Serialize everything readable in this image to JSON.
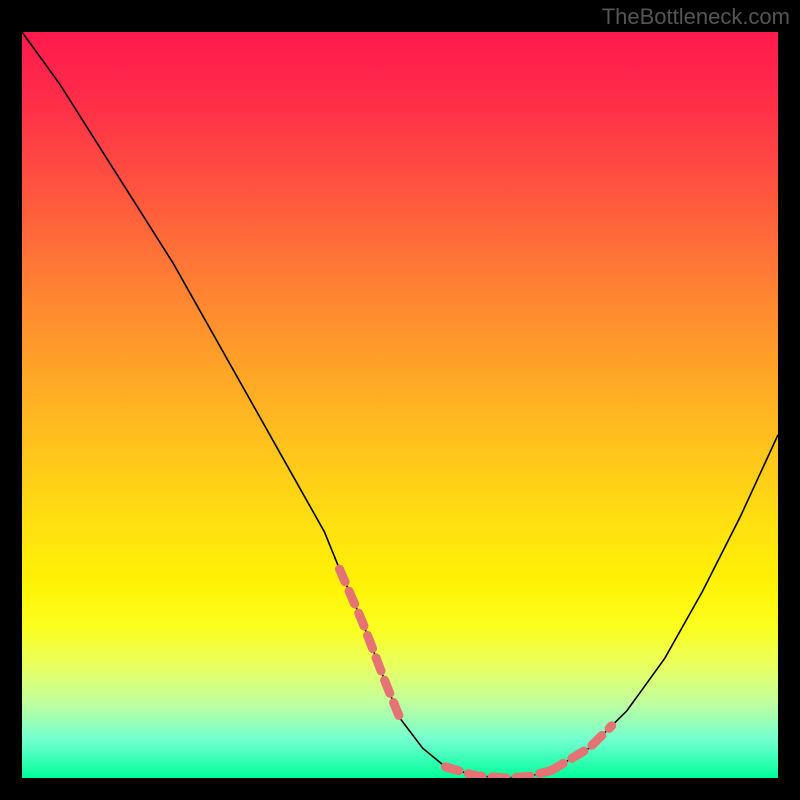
{
  "watermark": "TheBottleneck.com",
  "chart_data": {
    "type": "line",
    "title": "",
    "xlabel": "",
    "ylabel": "",
    "xlim": [
      0,
      100
    ],
    "ylim": [
      0,
      100
    ],
    "x": [
      0,
      5,
      10,
      15,
      20,
      25,
      30,
      35,
      40,
      42,
      45,
      48,
      50,
      53,
      56,
      60,
      64,
      67,
      70,
      75,
      80,
      85,
      90,
      95,
      100
    ],
    "values": [
      100,
      93,
      85,
      77,
      69,
      60,
      51,
      42,
      33,
      28,
      21,
      13,
      8,
      4,
      1.5,
      0.3,
      0,
      0.2,
      1,
      4,
      9,
      16,
      25,
      35,
      46
    ],
    "highlight_segments": [
      {
        "x_start": 42,
        "x_end": 50,
        "note": "left descent near bottom"
      },
      {
        "x_start": 56,
        "x_end": 70,
        "note": "valley floor"
      },
      {
        "x_start": 70,
        "x_end": 78,
        "note": "right ascent start"
      }
    ],
    "notes": "V-shaped curve over vertical red-to-green gradient background; salmon dotted overlay along lower portions of curve."
  }
}
